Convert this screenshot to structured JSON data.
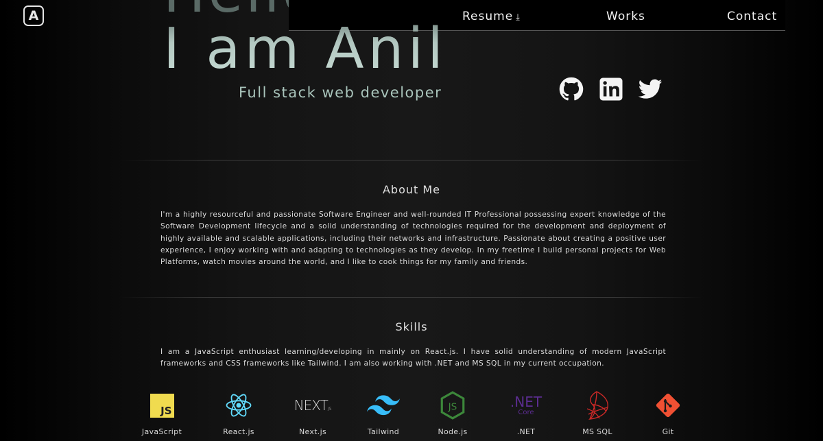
{
  "logo": {
    "letter": "A"
  },
  "nav": {
    "resume": "Resume",
    "resume_icon": "download-icon",
    "works": "Works",
    "contact": "Contact"
  },
  "hero": {
    "greeting": "Hello,",
    "name": "I am Anil",
    "subtitle": "Full stack web developer"
  },
  "social": [
    {
      "name": "github-icon"
    },
    {
      "name": "linkedin-icon"
    },
    {
      "name": "twitter-icon"
    }
  ],
  "about": {
    "title": "About Me",
    "text": "I'm a highly resourceful and passionate Software Engineer and well-rounded IT Professional possessing expert knowledge of the Software Development lifecycle and a solid understanding of technologies required for the development and deployment of highly available and scalable applications, including their networks and infrastructure. Passionate about creating a positive user experience, I enjoy working with and adapting to technologies as they develop. In my freetime I build personal projects for Web Platforms, watch movies around the world, and I like to cook things for my family and friends."
  },
  "skills": {
    "title": "Skills",
    "text": "I am a JavaScript enthusiast learning/developing in mainly on React.js. I have solid understanding of modern JavaScript frameworks and CSS frameworks like Tailwind. I am also working with .NET and MS SQL in my current occupation.",
    "items": [
      {
        "label": "JavaScript",
        "icon": "javascript-icon",
        "badge": "JS",
        "color": "#f0db4f"
      },
      {
        "label": "React.js",
        "icon": "react-icon",
        "color": "#61dafb"
      },
      {
        "label": "Next.js",
        "icon": "nextjs-icon",
        "badge": "NEXT",
        "sub": "JS"
      },
      {
        "label": "Tailwind",
        "icon": "tailwind-icon",
        "color": "#38bdf8"
      },
      {
        "label": "Node.js",
        "icon": "nodejs-icon",
        "badge": "JS",
        "color": "#3c873a"
      },
      {
        "label": ".NET",
        "icon": "dotnet-icon",
        "badge": ".NET",
        "sub": "Core",
        "color": "#5c2d91"
      },
      {
        "label": "MS SQL",
        "icon": "mssql-icon",
        "color": "#cc2927"
      },
      {
        "label": "Git",
        "icon": "git-icon",
        "color": "#f05033"
      }
    ]
  }
}
